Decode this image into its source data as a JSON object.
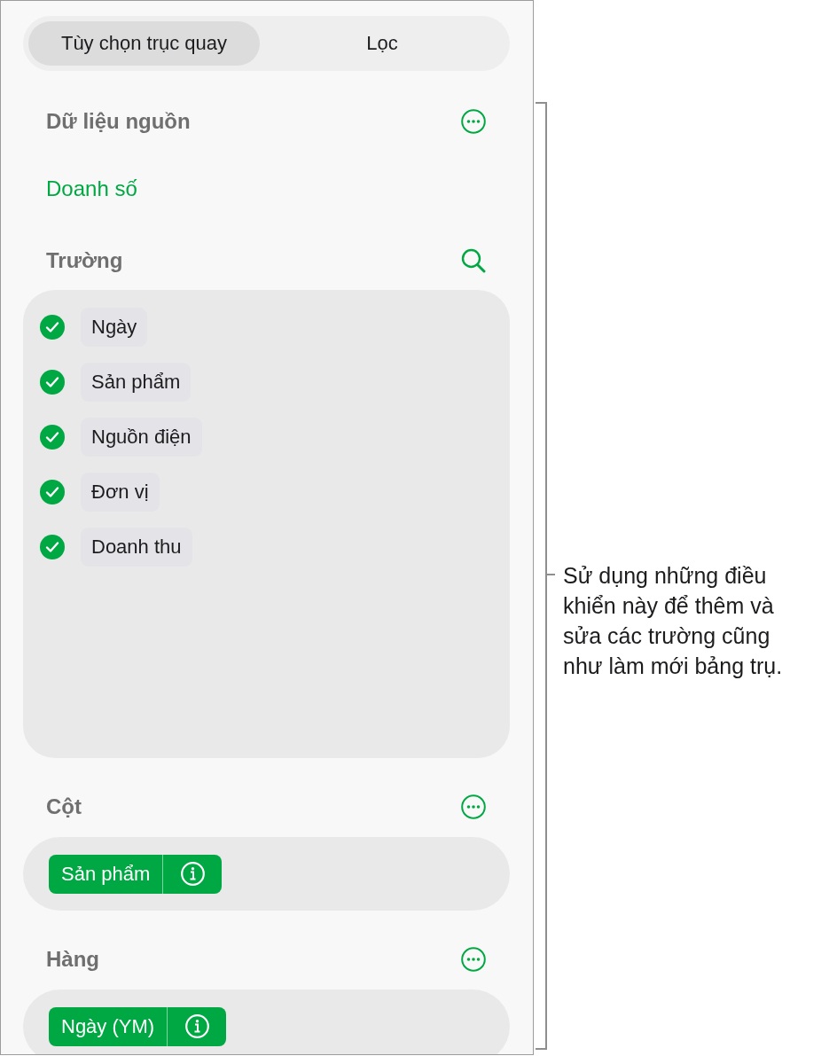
{
  "tabs": [
    {
      "label": "Tùy chọn trục quay",
      "selected": true
    },
    {
      "label": "Lọc",
      "selected": false
    }
  ],
  "source_data": {
    "heading": "Dữ liệu nguồn",
    "value": "Doanh số"
  },
  "fields": {
    "heading": "Trường",
    "items": [
      {
        "label": "Ngày",
        "checked": true
      },
      {
        "label": "Sản phẩm",
        "checked": true
      },
      {
        "label": "Nguồn điện",
        "checked": true
      },
      {
        "label": "Đơn vị",
        "checked": true
      },
      {
        "label": "Doanh thu",
        "checked": true
      }
    ]
  },
  "columns": {
    "heading": "Cột",
    "items": [
      {
        "label": "Sản phẩm"
      }
    ]
  },
  "rows": {
    "heading": "Hàng",
    "items": [
      {
        "label": "Ngày (YM)"
      }
    ]
  },
  "callout": {
    "text": "Sử dụng những điều khiển này để thêm và sửa các trường cũng như làm mới bảng trụ."
  }
}
